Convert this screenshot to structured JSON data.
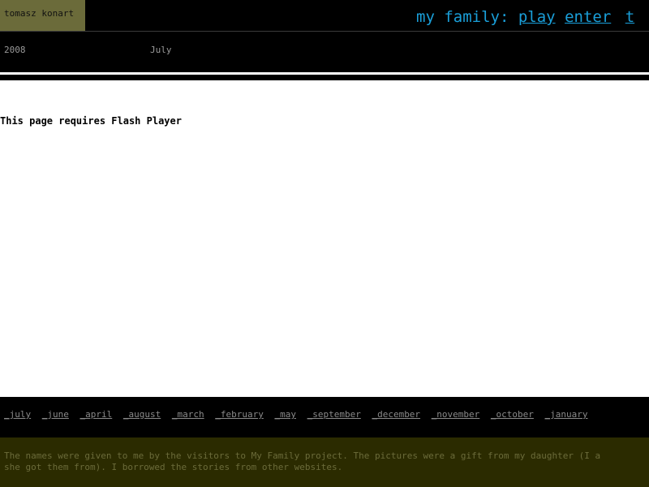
{
  "header": {
    "author": "tomasz konart",
    "project_label": "my family:",
    "links": [
      "play",
      "enter",
      "t"
    ]
  },
  "date": {
    "year": "2008",
    "month": "July"
  },
  "main": {
    "message": "This page requires Flash Player"
  },
  "months": [
    "_july",
    "_june",
    "_april",
    "_august",
    "_march",
    "_february",
    "_may",
    "_september",
    "_december",
    "_november",
    "_october",
    "_january"
  ],
  "footer": {
    "line1": "The names were given to me by the visitors to My Family project. The pictures were a gift from my daughter (I a",
    "line2": "she got them from). I borrowed the stories from other websites."
  },
  "colors": {
    "accent": "#1a9fd9",
    "badge": "#6b6b3a",
    "footer_bg": "#2b2b00"
  }
}
